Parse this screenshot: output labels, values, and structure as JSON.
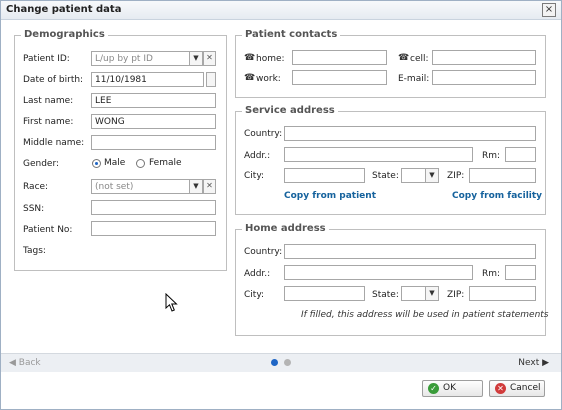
{
  "window": {
    "title": "Change patient data",
    "close": "×"
  },
  "demographics": {
    "legend": "Demographics",
    "patient_id": {
      "label": "Patient ID:",
      "placeholder": "L/up by pt ID"
    },
    "dob": {
      "label": "Date of birth:",
      "value": "11/10/1981"
    },
    "last_name": {
      "label": "Last name:",
      "value": "LEE"
    },
    "first_name": {
      "label": "First name:",
      "value": "WONG"
    },
    "middle_name": {
      "label": "Middle name:",
      "value": ""
    },
    "gender": {
      "label": "Gender:",
      "male": "Male",
      "female": "Female",
      "selected": "Male"
    },
    "race": {
      "label": "Race:",
      "placeholder": "(not set)"
    },
    "ssn": {
      "label": "SSN:",
      "value": ""
    },
    "patient_no": {
      "label": "Patient No:",
      "value": ""
    },
    "tags": {
      "label": "Tags:"
    }
  },
  "contacts": {
    "legend": "Patient contacts",
    "home": "home:",
    "cell": "cell:",
    "work": "work:",
    "email": "E-mail:"
  },
  "service_address": {
    "legend": "Service address",
    "country": "Country:",
    "addr": "Addr.:",
    "rm": "Rm:",
    "city": "City:",
    "state": "State:",
    "zip": "ZIP:",
    "copy_patient": "Copy from patient",
    "copy_facility": "Copy from facility"
  },
  "home_address": {
    "legend": "Home address",
    "country": "Country:",
    "addr": "Addr.:",
    "rm": "Rm:",
    "city": "City:",
    "state": "State:",
    "zip": "ZIP:",
    "note": "If filled, this address will be used in patient statements"
  },
  "nav": {
    "back": "◀ Back",
    "next": "Next ▶",
    "page_count": 2,
    "current_page": 1
  },
  "footer": {
    "ok": "OK",
    "cancel": "Cancel"
  },
  "icons": {
    "phone": "☎",
    "dropdown": "▼",
    "clear": "✕",
    "ok": "✓",
    "cancel": "✕"
  },
  "colors": {
    "link": "#15629d",
    "dot_active": "#1f66c5",
    "dot_inactive": "#b4b4b4",
    "ok_green": "#3a9c3a",
    "cancel_red": "#d13b3b"
  }
}
